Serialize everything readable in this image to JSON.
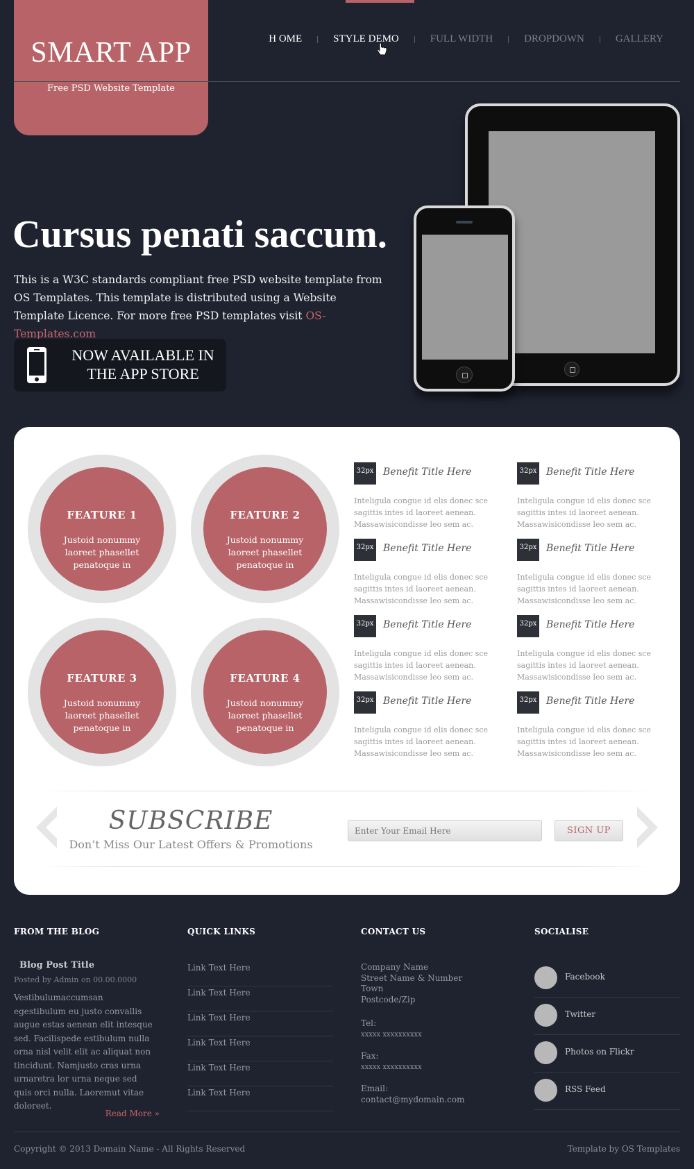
{
  "header": {
    "logo_title": "SMART APP",
    "logo_tagline": "Free PSD Website Template"
  },
  "nav": {
    "items": [
      {
        "label": "H OME"
      },
      {
        "label": "STYLE DEMO"
      },
      {
        "label": "FULL WIDTH"
      },
      {
        "label": "DROPDOWN"
      },
      {
        "label": "GALLERY"
      }
    ]
  },
  "hero": {
    "title": "Cursus penati saccum.",
    "text": "This is a W3C standards compliant free PSD website template from OS Templates. This template is distributed using a Website Template Licence. For more free PSD templates visit ",
    "link": "OS-Templates.com",
    "app_store_line1": "NOW AVAILABLE IN",
    "app_store_line2": "THE APP STORE"
  },
  "features": [
    {
      "title": "FEATURE 1",
      "text": "Justoid nonummy laoreet phasellet penatoque in"
    },
    {
      "title": "FEATURE 2",
      "text": "Justoid nonummy laoreet phasellet penatoque in"
    },
    {
      "title": "FEATURE 3",
      "text": "Justoid nonummy laoreet phasellet penatoque in"
    },
    {
      "title": "FEATURE 4",
      "text": "Justoid nonummy laoreet phasellet penatoque in"
    }
  ],
  "benefits": [
    {
      "icon": "32px",
      "title": "Benefit Title Here",
      "text": "Inteligula congue id elis donec sce sagittis intes id laoreet aenean. Massawisicondisse leo sem ac."
    },
    {
      "icon": "32px",
      "title": "Benefit Title Here",
      "text": "Inteligula congue id elis donec sce sagittis intes id laoreet aenean. Massawisicondisse leo sem ac."
    },
    {
      "icon": "32px",
      "title": "Benefit Title Here",
      "text": "Inteligula congue id elis donec sce sagittis intes id laoreet aenean. Massawisicondisse leo sem ac."
    },
    {
      "icon": "32px",
      "title": "Benefit Title Here",
      "text": "Inteligula congue id elis donec sce sagittis intes id laoreet aenean. Massawisicondisse leo sem ac."
    },
    {
      "icon": "32px",
      "title": "Benefit Title Here",
      "text": "Inteligula congue id elis donec sce sagittis intes id laoreet aenean. Massawisicondisse leo sem ac."
    },
    {
      "icon": "32px",
      "title": "Benefit Title Here",
      "text": "Inteligula congue id elis donec sce sagittis intes id laoreet aenean. Massawisicondisse leo sem ac."
    },
    {
      "icon": "32px",
      "title": "Benefit Title Here",
      "text": "Inteligula congue id elis donec sce sagittis intes id laoreet aenean. Massawisicondisse leo sem ac."
    },
    {
      "icon": "32px",
      "title": "Benefit Title Here",
      "text": "Inteligula congue id elis donec sce sagittis intes id laoreet aenean. Massawisicondisse leo sem ac."
    }
  ],
  "subscribe": {
    "title": "SUBSCRIBE",
    "subtitle": "Don’t Miss Our Latest Offers & Promotions",
    "email_placeholder": "Enter Your Email Here",
    "button": "SIGN UP"
  },
  "footer": {
    "blog": {
      "heading": "FROM THE BLOG",
      "post_title": "Blog Post Title",
      "meta": "Posted by Admin on 00.00.0000",
      "body": "Vestibulumaccumsan egestibulum eu justo convallis augue estas aenean elit intesque sed. Facilispede estibulum nulla orna nisl velit elit ac aliquat non tincidunt. Namjusto cras urna urnaretra lor urna neque sed quis orci nulla. Laoremut vitae doloreet.",
      "read_more": "Read More »"
    },
    "quick_links": {
      "heading": "QUICK LINKS",
      "items": [
        "Link Text Here",
        "Link Text Here",
        "Link Text Here",
        "Link Text Here",
        "Link Text Here",
        "Link Text Here"
      ]
    },
    "contact": {
      "heading": "CONTACT US",
      "address": [
        "Company Name",
        "Street Name & Number",
        "Town",
        "Postcode/Zip"
      ],
      "tel_label": "Tel:",
      "tel": "xxxxx xxxxxxxxxx",
      "fax_label": "Fax:",
      "fax": "xxxxx xxxxxxxxxx",
      "email_label": "Email:",
      "email": "contact@mydomain.com"
    },
    "social": {
      "heading": "SOCIALISE",
      "items": [
        "Facebook",
        "Twitter",
        "Photos on Flickr",
        "RSS Feed"
      ]
    },
    "copyright": "Copyright © 2013 Domain Name - All Rights Reserved",
    "template_by": "Template by OS Templates"
  },
  "colors": {
    "background": "#1f2330",
    "accent": "#b76368",
    "panel": "#ffffff"
  }
}
